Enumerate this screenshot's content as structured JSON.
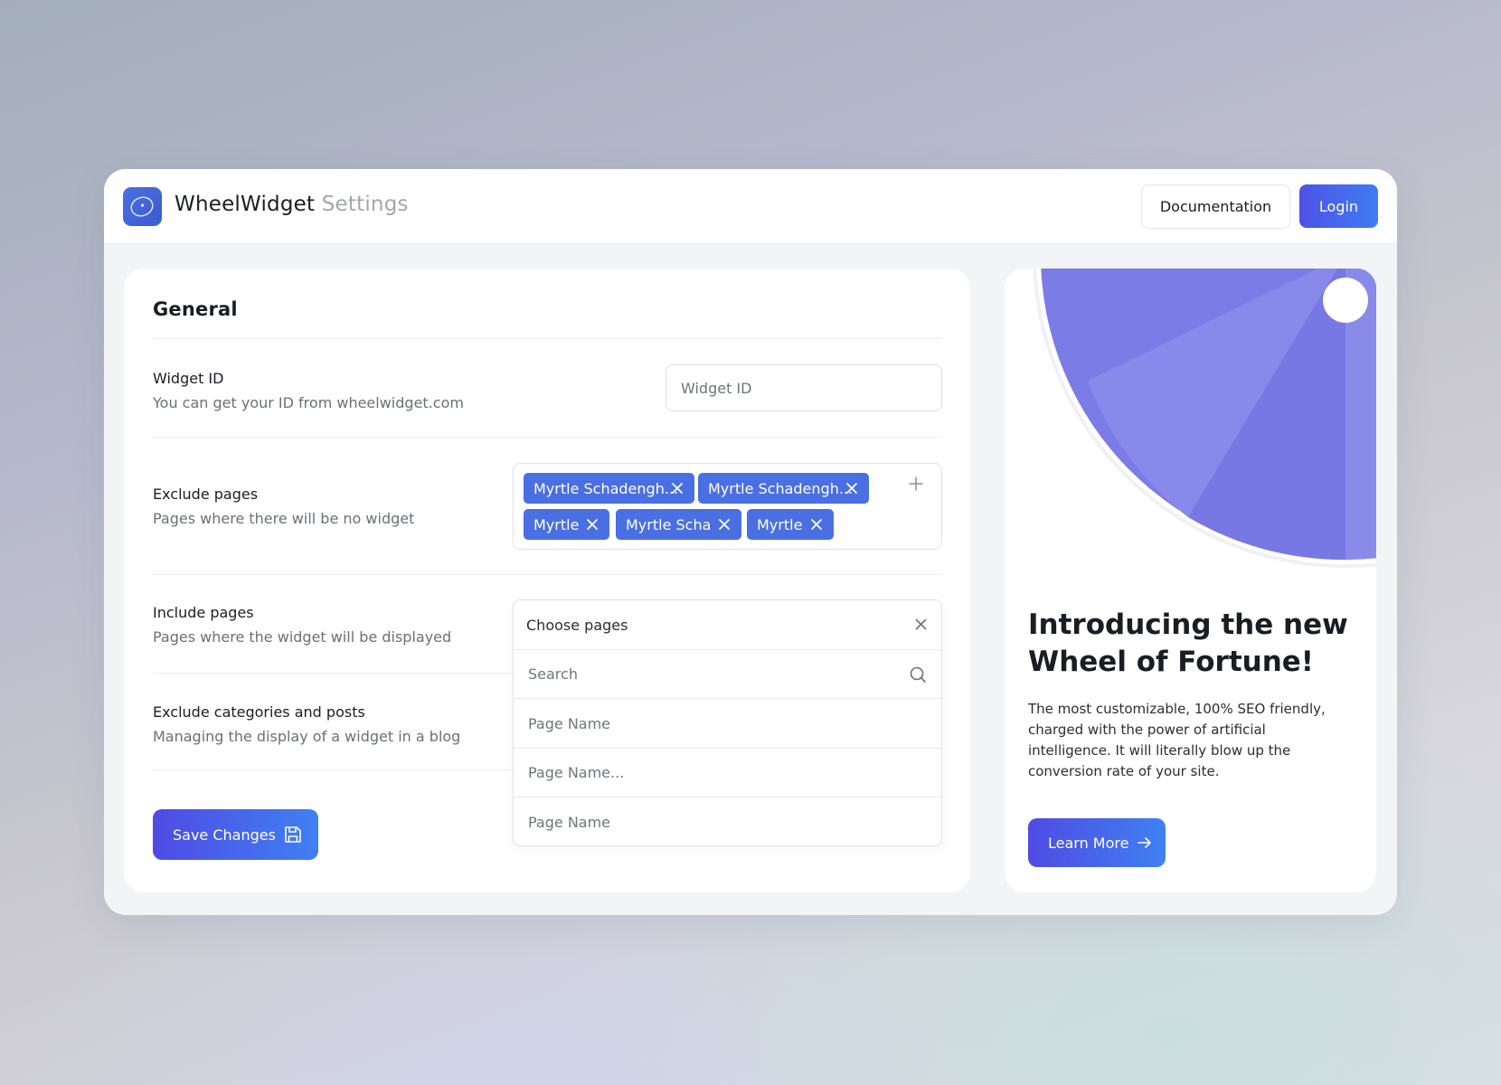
{
  "app": {
    "brand_name": "WheelWidget",
    "brand_suffix": "Settings",
    "logo_icon": "wheel-logo-icon"
  },
  "header": {
    "documentation_label": "Documentation",
    "login_label": "Login"
  },
  "general": {
    "title": "General",
    "widget_id": {
      "title": "Widget ID",
      "subtitle": "You can get your ID from wheelwidget.com",
      "placeholder": "Widget ID"
    },
    "exclude_pages": {
      "title": "Exclude pages",
      "subtitle": "Pages where there will be no widget",
      "tags": [
        "Myrtle Schadengh...",
        "Myrtle Schadengh...",
        "Myrtle",
        "Myrtle Scha",
        "Myrtle"
      ]
    },
    "include_pages": {
      "title": "Include pages",
      "subtitle": "Pages where the widget will be displayed",
      "dropdown_label": "Choose pages",
      "search_placeholder": "Search",
      "options": [
        "Page Name",
        "Page Name...",
        "Page Name"
      ]
    },
    "exclude_categories": {
      "title": "Exclude categories and posts",
      "subtitle": "Managing the display of a widget in a blog"
    },
    "save_label": "Save Changes"
  },
  "promo": {
    "title": "Introducing the new Wheel of Fortune!",
    "body": "The most customizable, 100% SEO friendly, charged with the power of artificial intelligence. It will literally blow up the conversion rate of your site.",
    "cta_label": "Learn More"
  },
  "colors": {
    "accent": "#4a6fe3",
    "button_gradient_start": "#4f4be3",
    "button_gradient_end": "#3f80f3",
    "wheel_purple": "#7b7ce6"
  }
}
